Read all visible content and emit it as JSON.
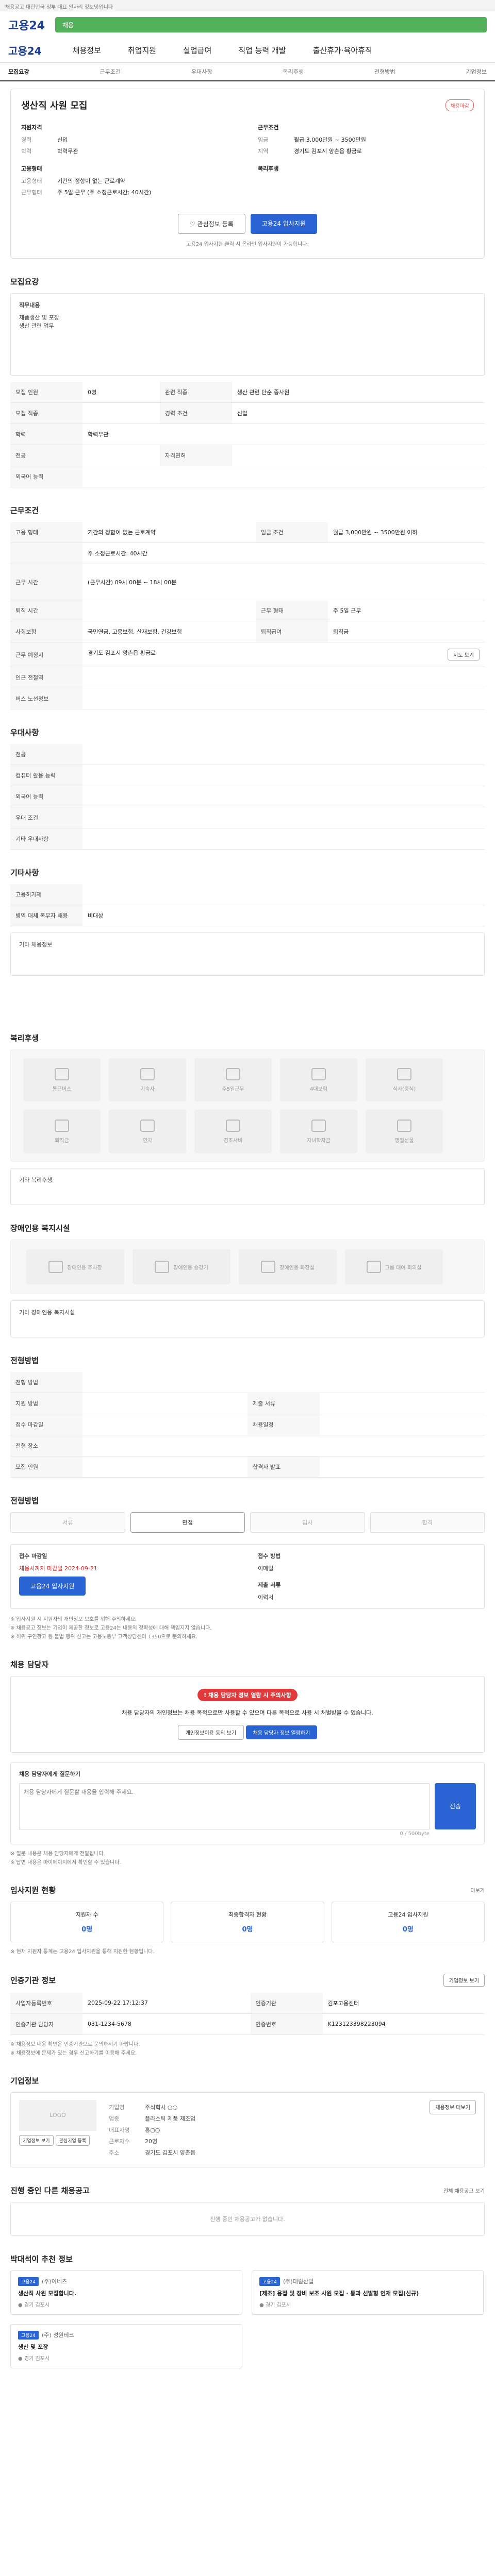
{
  "topbar": {
    "text": "채용공고 대한민국 정부 대표 일자리 정보망입니다"
  },
  "brand": {
    "logo": "고용24"
  },
  "greenbar": {
    "text": "채용"
  },
  "gnb": {
    "items": [
      "채용정보",
      "취업지원",
      "실업급여",
      "직업 능력 개발",
      "출산휴가·육아휴직"
    ]
  },
  "subtabs": {
    "items": [
      "모집요강",
      "근무조건",
      "우대사항",
      "복리후생",
      "전형방법",
      "기업정보"
    ]
  },
  "summary": {
    "title": "생산직 사원 모집",
    "badge": "채용마감",
    "left_header": "지원자격",
    "career_label": "경력",
    "career": "신입",
    "edu_label": "학력",
    "edu": "학력무관",
    "emp_label": "고용형태",
    "emp_type": "기간의 정함이 없는 근로계약",
    "work_label": "근무형태",
    "work_type": "주 5일 근무 (주 소정근로시간: 40시간)",
    "right_header": "근무조건",
    "wage_label": "임금",
    "wage": "월급 3,000만원 ~ 3500만원",
    "loc_label": "지역",
    "loc": "경기도 김포시 양촌읍 황금로",
    "welfare_label": "복리후생",
    "save_btn": "관심정보 등록",
    "apply_btn": "고용24 입사지원",
    "notice": "고용24 입사지원 클릭 시 온라인 입사지원이 가능합니다."
  },
  "recruit": {
    "title": "모집요강",
    "duty_label": "직무내용",
    "duty_lines": [
      "제품생산 및 포장",
      "생산 관련 업무"
    ],
    "rows": [
      [
        "모집 인원",
        "0명",
        "관련 직종",
        "생산 관련 단순 종사원"
      ],
      [
        "모집 직종",
        "",
        "경력 조건",
        "신입"
      ],
      [
        "학력",
        "학력무관",
        "",
        ""
      ],
      [
        "전공",
        "",
        "자격면허",
        ""
      ],
      [
        "외국어 능력",
        "",
        "",
        ""
      ]
    ]
  },
  "work": {
    "title": "근무조건",
    "rows": [
      [
        "고용 형태",
        "기간의 정함이 없는 근로계약",
        "임금 조건",
        "월급 3,000만원 ~ 3500만원 이하"
      ],
      [
        "",
        "주 소정근로시간: 40시간",
        "",
        ""
      ],
      [
        "근무 시간",
        "(근무시간) 09시 00분 ~ 18시 00분",
        "",
        ""
      ],
      [
        "퇴직 시간",
        "",
        "근무 형태",
        "주 5일 근무"
      ],
      [
        "사회보험",
        "국민연금, 고용보험, 산재보험, 건강보험",
        "퇴직급여",
        "퇴직금"
      ],
      [
        "근무 예정지",
        "경기도 김포시 양촌읍 황금로",
        "",
        ""
      ],
      [
        "인근 전철역",
        "",
        "",
        ""
      ],
      [
        "버스 노선정보",
        "",
        "",
        ""
      ]
    ],
    "map_btn": "지도 보기"
  },
  "preferred": {
    "title": "우대사항",
    "rows": [
      "전공",
      "컴퓨터 활용 능력",
      "외국어 능력",
      "우대 조건",
      "기타 우대사항"
    ],
    "disability_title": "기타사항",
    "disability_rows": [
      "고용허가제",
      "병역 대체 복무자 채용"
    ],
    "disability_vals": [
      "",
      "비대상"
    ],
    "detail_label": "기타 채용정보"
  },
  "benefits": {
    "title": "복리후생",
    "items": [
      "통근버스",
      "기숙사",
      "주5일근무",
      "4대보험",
      "식사(중식)",
      "퇴직금",
      "연차",
      "경조사비",
      "자녀학자금",
      "명절선물"
    ],
    "etc_label": "기타 복리후생"
  },
  "disability": {
    "title": "장애인용 복지시설",
    "items": [
      "장애인용 주차장",
      "장애인용 승강기",
      "장애인용 화장실",
      "그룹 대여 회의실"
    ],
    "etc_label": "기타 장애인용 복지시설"
  },
  "process": {
    "title": "전형방법",
    "rows": [
      [
        "전형 방법",
        "",
        "",
        ""
      ],
      [
        "지원 방법",
        "",
        "제출 서류",
        ""
      ],
      [
        "접수 마감일",
        "",
        "채용일정",
        ""
      ],
      [
        "전형 장소",
        "",
        "",
        ""
      ],
      [
        "모집 인원",
        "",
        "합격자 발표",
        ""
      ]
    ],
    "steps": [
      "서류",
      "면접",
      "입사",
      "합격"
    ],
    "apply_label": "접수 마감일",
    "apply_value": "채용시까지 마감일 2024-09-21",
    "method_label": "접수 방법",
    "method_value": "이메일",
    "docs_label": "제출 서류",
    "docs_value": "이력서",
    "apply_btn": "고용24 입사지원",
    "notes": [
      "※ 입사지원 시 지원자의 개인정보 보호를 위해 주의하세요.",
      "※ 채용공고 정보는 기업이 제공한 정보로 고용24는 내용의 정확성에 대해 책임지지 않습니다.",
      "※ 허위 구인광고 등 불법 행위 신고는 고용노동부 고객상담센터 1350으로 문의하세요."
    ]
  },
  "contact": {
    "title": "채용 담당자",
    "alert": "채용 담당자 정보 열람 시 주의사항",
    "alert_text": "채용 담당자의 개인정보는 채용 목적으로만 사용할 수 있으며 다른 목적으로 사용 시 처벌받을 수 있습니다.",
    "btn1": "개인정보이용 동의 보기",
    "btn2": "채용 담당자 정보 열람하기",
    "qna_title": "채용 담당자에게 질문하기",
    "qna_placeholder": "채용 담당자에게 질문할 내용을 입력해 주세요.",
    "qna_count": "0 / 500byte",
    "qna_btn": "전송",
    "notes": [
      "※ 질문 내용은 채용 담당자에게 전달됩니다.",
      "※ 답변 내용은 마이페이지에서 확인할 수 있습니다."
    ]
  },
  "applicants": {
    "title": "입사지원 현황",
    "more": "더보기",
    "cards": [
      [
        "지원자 수",
        "0명"
      ],
      [
        "최종합격자 현황",
        "0명"
      ],
      [
        "고용24 입사지원",
        "0명"
      ]
    ],
    "note": "※ 현재 지원자 통계는 고용24 입사지원을 통해 지원한 현황입니다."
  },
  "info": {
    "title": "인증기관 정보",
    "btn": "기업정보 보기",
    "rows": [
      [
        "사업자등록번호",
        "2025-09-22 17:12:37",
        "인증기관",
        "김포고용센터"
      ],
      [
        "인증기관 담당자",
        "031-1234-5678",
        "인증번호",
        "K123123398223094"
      ]
    ],
    "notes": [
      "※ 채용정보 내용 확인은 인증기관으로 문의하시기 바랍니다.",
      "※ 채용정보에 문제가 있는 경우 신고하기를 이용해 주세요."
    ]
  },
  "company": {
    "title": "기업정보",
    "logo_text": "LOGO",
    "labels": [
      "기업명",
      "업종",
      "대표자명",
      "근로자수",
      "주소"
    ],
    "values": [
      "주식회사 ○○",
      "플라스틱 제품 제조업",
      "홍○○",
      "20명",
      "경기도 김포시 양촌읍"
    ],
    "btn": "채용정보 더보기",
    "small_btns": [
      "기업정보 보기",
      "관심기업 등록"
    ]
  },
  "other_jobs": {
    "title": "진행 중인 다른 채용공고",
    "more": "전체 채용공고 보기",
    "empty": "진행 중인 채용공고가 없습니다."
  },
  "recommend": {
    "title": "박대석이 추천 정보",
    "cards": [
      {
        "tag": "고용24",
        "company": "(주)이네츠",
        "title": "생산직 사원 모집합니다.",
        "meta": "경기 김포시"
      },
      {
        "tag": "고용24",
        "company": "(주)대림산업",
        "title": "[제조] 용접 및 장비 보조 사원 모집 · 통과 선발형 인재 모집(신규)",
        "meta": "경기 김포시"
      },
      {
        "tag": "고용24",
        "company": "(주) 성원테크",
        "title": "생산 및 포장",
        "meta": "경기 김포시"
      }
    ]
  }
}
